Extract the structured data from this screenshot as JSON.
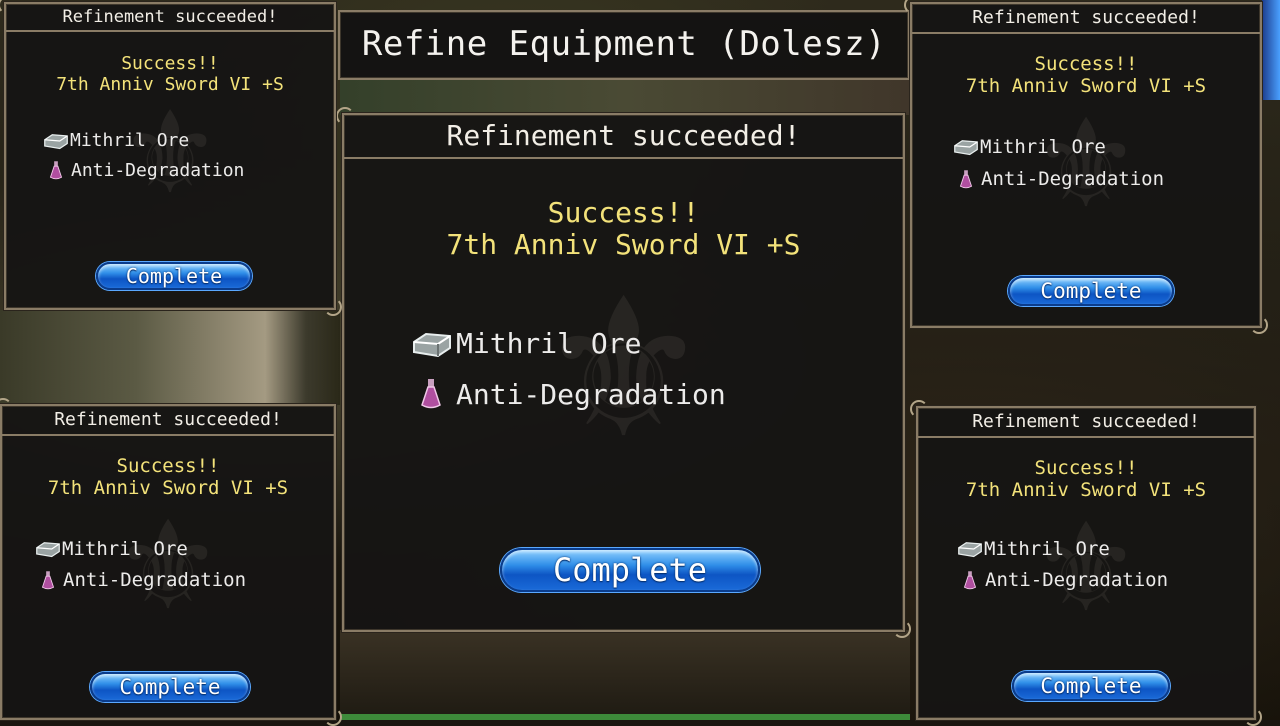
{
  "header": {
    "title": "Refine Equipment (Dolesz)"
  },
  "dialogs": [
    {
      "id": "center",
      "title": "Refinement succeeded!",
      "success_line": "Success!!",
      "item_line": "7th Anniv Sword VI +S",
      "materials": [
        {
          "icon": "mithril-ore-icon",
          "label": "Mithril Ore"
        },
        {
          "icon": "anti-degradation-potion-icon",
          "label": "Anti-Degradation"
        }
      ],
      "button_label": "Complete"
    },
    {
      "id": "top-left",
      "title": "Refinement succeeded!",
      "success_line": "Success!!",
      "item_line": "7th Anniv Sword VI +S",
      "materials": [
        {
          "icon": "mithril-ore-icon",
          "label": "Mithril Ore"
        },
        {
          "icon": "anti-degradation-potion-icon",
          "label": "Anti-Degradation"
        }
      ],
      "button_label": "Complete"
    },
    {
      "id": "top-right",
      "title": "Refinement succeeded!",
      "success_line": "Success!!",
      "item_line": "7th Anniv Sword VI +S",
      "materials": [
        {
          "icon": "mithril-ore-icon",
          "label": "Mithril Ore"
        },
        {
          "icon": "anti-degradation-potion-icon",
          "label": "Anti-Degradation"
        }
      ],
      "button_label": "Complete"
    },
    {
      "id": "bottom-left",
      "title": "Refinement succeeded!",
      "success_line": "Success!!",
      "item_line": "7th Anniv Sword VI +S",
      "materials": [
        {
          "icon": "mithril-ore-icon",
          "label": "Mithril Ore"
        },
        {
          "icon": "anti-degradation-potion-icon",
          "label": "Anti-Degradation"
        }
      ],
      "button_label": "Complete"
    },
    {
      "id": "bottom-right",
      "title": "Refinement succeeded!",
      "success_line": "Success!!",
      "item_line": "7th Anniv Sword VI +S",
      "materials": [
        {
          "icon": "mithril-ore-icon",
          "label": "Mithril Ore"
        },
        {
          "icon": "anti-degradation-potion-icon",
          "label": "Anti-Degradation"
        }
      ],
      "button_label": "Complete"
    }
  ],
  "colors": {
    "success_text": "#f3e27a",
    "button_blue": "#1a6ad8",
    "frame_border": "#8a7c66",
    "panel_bg": "#161514"
  }
}
